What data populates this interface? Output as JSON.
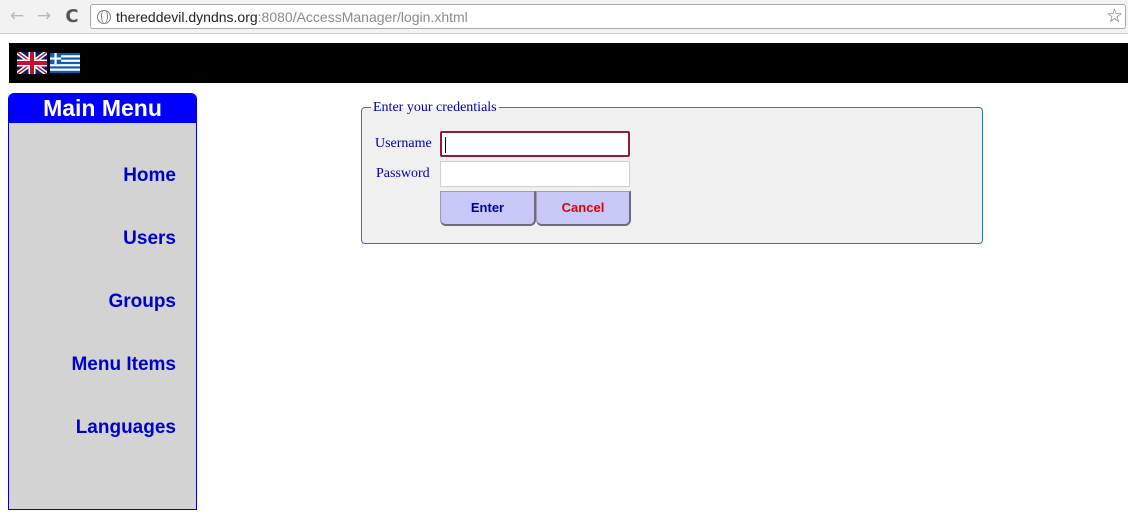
{
  "browser": {
    "back_glyph": "←",
    "forward_glyph": "→",
    "reload_glyph": "C",
    "url_host": "thereddevil.dyndns.org",
    "url_rest": ":8080/AccessManager/login.xhtml",
    "star_glyph": "☆"
  },
  "header": {
    "languages": [
      {
        "icon": "uk-flag-icon"
      },
      {
        "icon": "greek-flag-icon"
      }
    ]
  },
  "sidebar": {
    "title": "Main Menu",
    "items": [
      {
        "label": "Home"
      },
      {
        "label": "Users"
      },
      {
        "label": "Groups"
      },
      {
        "label": "Menu Items"
      },
      {
        "label": "Languages"
      }
    ]
  },
  "login": {
    "legend": "Enter your credentials",
    "username_label": "Username",
    "username_value": "",
    "password_label": "Password",
    "password_value": "",
    "enter_label": "Enter",
    "cancel_label": "Cancel"
  },
  "colors": {
    "menu_header": "#0000ff",
    "menu_text": "#0000cc",
    "sidebar_bg": "#d3d3d3",
    "button_bg": "#c8c8f8",
    "cancel_text": "#dd0000"
  }
}
